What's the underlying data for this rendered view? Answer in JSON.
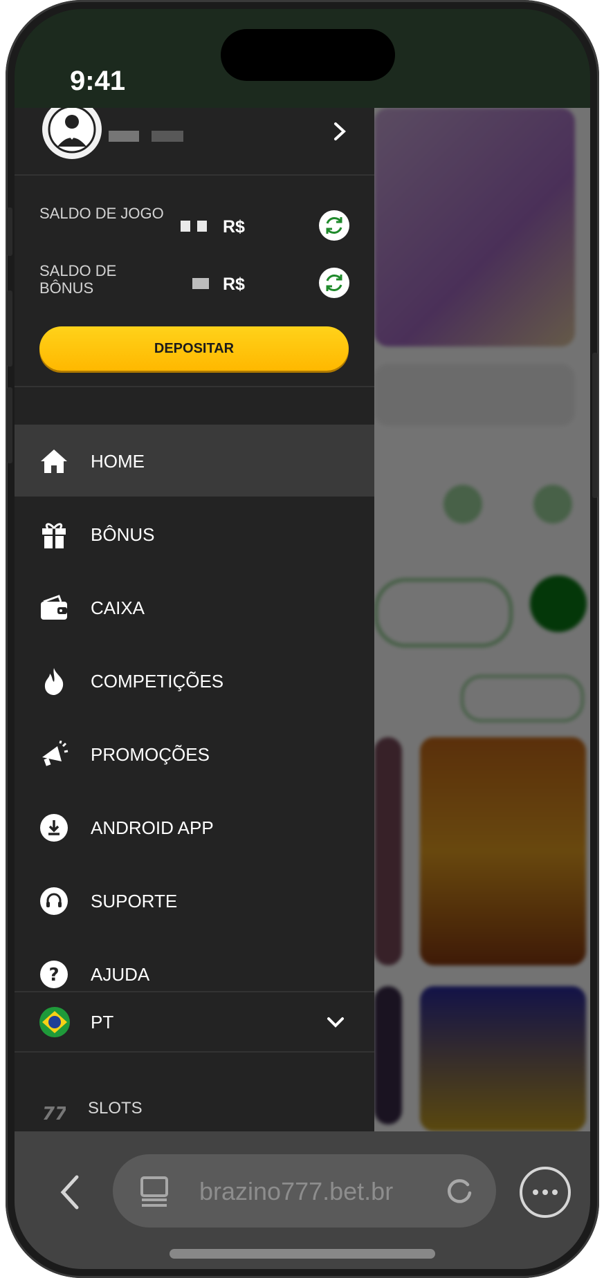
{
  "status_bar": {
    "time": "9:41"
  },
  "balances": {
    "game_label": "SALDO DE JOGO",
    "game_currency": "R$",
    "bonus_label": "SALDO DE BÔNUS",
    "bonus_currency": "R$"
  },
  "deposit_label": "DEPOSITAR",
  "menu": [
    {
      "label": "HOME",
      "icon": "home-icon",
      "active": true
    },
    {
      "label": "BÔNUS",
      "icon": "gift-icon",
      "active": false
    },
    {
      "label": "CAIXA",
      "icon": "wallet-icon",
      "active": false
    },
    {
      "label": "COMPETIÇÕES",
      "icon": "fire-icon",
      "active": false
    },
    {
      "label": "PROMOÇÕES",
      "icon": "megaphone-icon",
      "active": false
    },
    {
      "label": "ANDROID APP",
      "icon": "download-icon",
      "active": false
    },
    {
      "label": "SUPORTE",
      "icon": "headset-icon",
      "active": false
    },
    {
      "label": "AJUDA",
      "icon": "help-icon",
      "active": false
    }
  ],
  "language": {
    "code": "PT",
    "flag_icon": "brazil-flag-icon"
  },
  "section_label": "SLOTS",
  "browser": {
    "url": "brazino777.bet.br"
  },
  "colors": {
    "accent": "#ffc800",
    "drawer_bg": "#232323",
    "refresh_green": "#1f8a2b"
  }
}
